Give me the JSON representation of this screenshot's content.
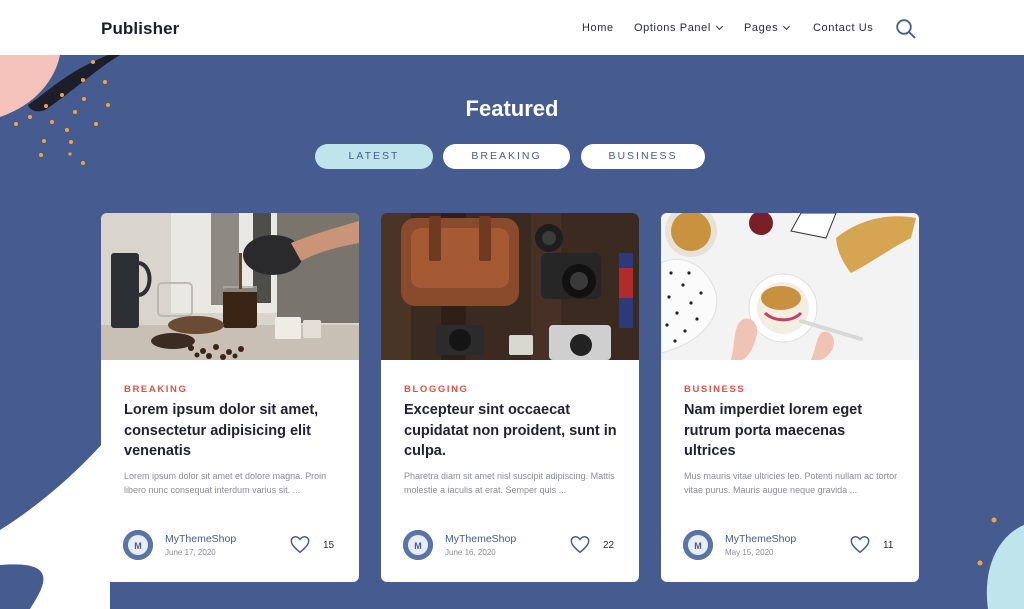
{
  "header": {
    "logo": "Publisher",
    "nav": [
      {
        "label": "Home",
        "has_dropdown": false
      },
      {
        "label": "Options Panel",
        "has_dropdown": true
      },
      {
        "label": "Pages",
        "has_dropdown": true
      },
      {
        "label": "Contact Us",
        "has_dropdown": false
      }
    ],
    "search_icon": "search-icon"
  },
  "featured": {
    "title": "Featured",
    "tabs": [
      {
        "label": "LATEST",
        "active": true
      },
      {
        "label": "BREAKING",
        "active": false
      },
      {
        "label": "BUSINESS",
        "active": false
      }
    ]
  },
  "cards": [
    {
      "category": "BREAKING",
      "title": "Lorem ipsum dolor sit amet, consectetur adipisicing elit venenatis",
      "excerpt": "Lorem ipsum dolor sit amet et dolore magna. Proin libero nunc consequat interdum varius sit. ...",
      "author": "MyThemeShop",
      "date": "June 17, 2020",
      "likes": "15",
      "image": "coffee-pour-photo"
    },
    {
      "category": "BLOGGING",
      "title": "Excepteur sint occaecat cupidatat non proident, sunt in culpa.",
      "excerpt": "Pharetra diam sit amet nisl suscipit adipiscing. Mattis molestie a iaculis at erat. Semper quis ...",
      "author": "MyThemeShop",
      "date": "June 16, 2020",
      "likes": "22",
      "image": "camera-bag-photo"
    },
    {
      "category": "BUSINESS",
      "title": "Nam imperdiet lorem eget rutrum porta maecenas ultrices",
      "excerpt": "Mus mauris vitae ultricies leo. Potenti nullam ac tortor vitae purus. Mauris augue neque gravida ...",
      "author": "MyThemeShop",
      "date": "May 15, 2020",
      "likes": "11",
      "image": "granola-bowl-photo"
    }
  ],
  "colors": {
    "section_bg": "#465b8f",
    "accent_red": "#e2513f",
    "tab_active": "#bfe4ec",
    "deco_pink": "#f6c3bb",
    "deco_orange": "#f0a53a"
  }
}
